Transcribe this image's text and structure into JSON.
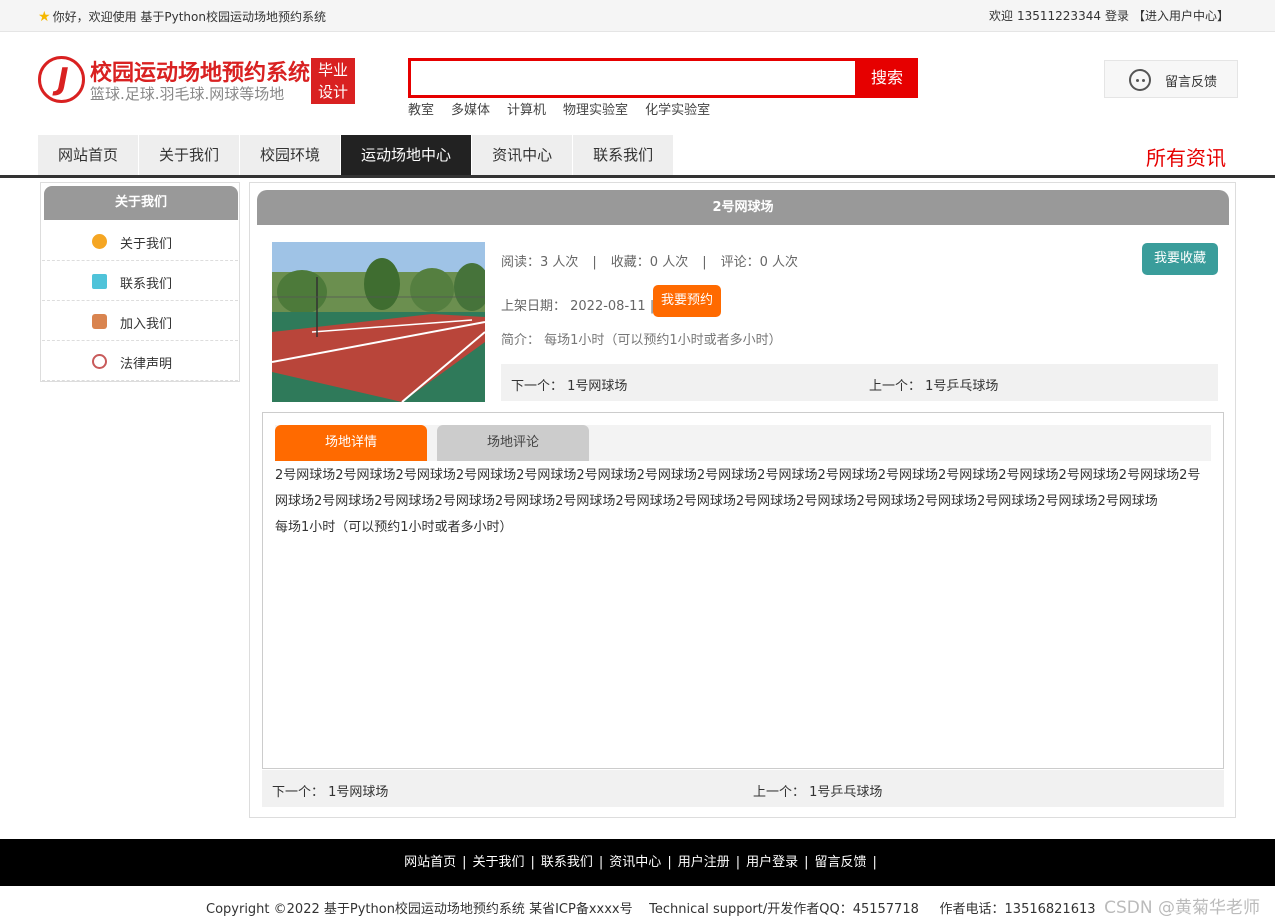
{
  "topbar": {
    "greeting": "你好，欢迎使用 基于Python校园运动场地预约系统",
    "welcome_label": "欢迎",
    "user_phone": "13511223344",
    "login_link": "登录",
    "user_center_link": "【进入用户中心】"
  },
  "header": {
    "logo_letter": "J",
    "site_title": "校园运动场地预约系统",
    "site_subtitle": "篮球.足球.羽毛球.网球等场地",
    "badge_line1": "毕业",
    "badge_line2": "设计",
    "search_value": "",
    "search_button": "搜索",
    "hot_words": [
      "教室",
      "多媒体",
      "计算机",
      "物理实验室",
      "化学实验室"
    ],
    "feedback_label": "留言反馈"
  },
  "nav": {
    "items": [
      "网站首页",
      "关于我们",
      "校园环境",
      "运动场地中心",
      "资讯中心",
      "联系我们"
    ],
    "active_index": 3,
    "right_label": "所有资讯"
  },
  "sidebar": {
    "title": "关于我们",
    "items": [
      {
        "label": "关于我们",
        "icon": "info-icon"
      },
      {
        "label": "联系我们",
        "icon": "clipboard-icon"
      },
      {
        "label": "加入我们",
        "icon": "lock-icon"
      },
      {
        "label": "法律声明",
        "icon": "power-icon"
      }
    ]
  },
  "venue": {
    "title": "2号网球场",
    "reads": "阅读：3 人次",
    "favorites": "收藏：0 人次",
    "comments": "评论：0 人次",
    "favorite_button": "我要收藏",
    "listed_date": "上架日期： 2022-08-11 |",
    "book_button": "我要预约",
    "intro": "简介： 每场1小时（可以预约1小时或者多小时）",
    "next_label": "下一个：",
    "next_value": "1号网球场",
    "prev_label": "上一个：",
    "prev_value": "1号乒乓球场"
  },
  "detail": {
    "tab_details": "场地详情",
    "tab_comments": "场地评论",
    "content_line1": "2号网球场2号网球场2号网球场2号网球场2号网球场2号网球场2号网球场2号网球场2号网球场2号网球场2号网球场2号网球场2号网球场2号网球场2号网球场2号网球场2号网球场2号网球场2号网球场2号网球场2号网球场2号网球场2号网球场2号网球场2号网球场2号网球场2号网球场2号网球场2号网球场2号网球场",
    "content_line2": "每场1小时（可以预约1小时或者多小时）",
    "bottom_next_label": "下一个：",
    "bottom_next_value": "1号网球场",
    "bottom_prev_label": "上一个：",
    "bottom_prev_value": "1号乒乓球场"
  },
  "footer": {
    "links": [
      "网站首页",
      "关于我们",
      "联系我们",
      "资讯中心",
      "用户注册",
      "用户登录",
      "留言反馈"
    ],
    "copyright": "Copyright ©2022 基于Python校园运动场地预约系统 某省ICP备xxxx号    Technical support/开发作者QQ：45157718     作者电话：13516821613",
    "watermark": "CSDN @黄菊华老师"
  },
  "colors": {
    "brand_red": "#d92121",
    "search_red": "#e60000",
    "accent_orange": "#ff6a00",
    "teal_button": "#3a9d9b",
    "nav_active": "#222222",
    "panel_gray": "#999999"
  }
}
